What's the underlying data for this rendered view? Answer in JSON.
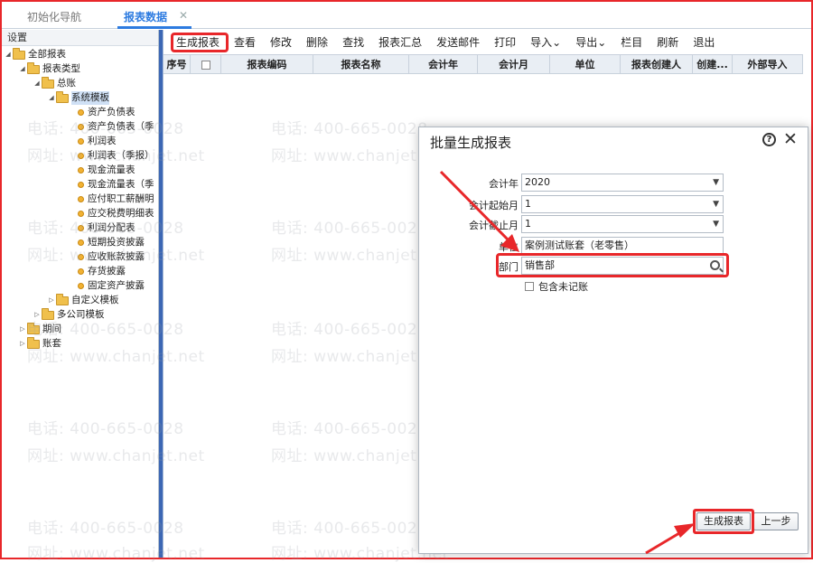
{
  "tabs": [
    {
      "label": "初始化导航"
    },
    {
      "label": "报表数据",
      "close": "✕"
    }
  ],
  "left": {
    "header": "设置",
    "tree": [
      {
        "label": "全部报表",
        "icon": "folder-icon"
      },
      {
        "label": "报表类型",
        "icon": "folder-icon"
      },
      {
        "label": "总账",
        "icon": "folder-icon"
      },
      {
        "label": "系统模板",
        "icon": "folder-icon"
      },
      {
        "label": "资产负债表",
        "icon": "report-icon"
      },
      {
        "label": "资产负债表（季",
        "icon": "report-icon"
      },
      {
        "label": "利润表",
        "icon": "report-icon"
      },
      {
        "label": "利润表（季报）",
        "icon": "report-icon"
      },
      {
        "label": "现金流量表",
        "icon": "report-icon"
      },
      {
        "label": "现金流量表（季",
        "icon": "report-icon"
      },
      {
        "label": "应付职工薪酬明",
        "icon": "report-icon"
      },
      {
        "label": "应交税费明细表",
        "icon": "report-icon"
      },
      {
        "label": "利润分配表",
        "icon": "report-icon"
      },
      {
        "label": "短期投资披露",
        "icon": "report-icon"
      },
      {
        "label": "应收账款披露",
        "icon": "report-icon"
      },
      {
        "label": "存货披露",
        "icon": "report-icon"
      },
      {
        "label": "固定资产披露",
        "icon": "report-icon"
      },
      {
        "label": "自定义模板",
        "icon": "folder-icon"
      },
      {
        "label": "多公司模板",
        "icon": "folder-icon"
      },
      {
        "label": "期间",
        "icon": "folder-icon"
      },
      {
        "label": "账套",
        "icon": "folder-icon"
      }
    ]
  },
  "toolbar": {
    "buttons": [
      "生成报表",
      "查看",
      "修改",
      "删除",
      "查找",
      "报表汇总",
      "发送邮件",
      "打印",
      "导入",
      "导出",
      "栏目",
      "刷新",
      "退出"
    ],
    "dropdown_caret": "⌄"
  },
  "grid": {
    "columns": [
      "序号",
      "",
      "报表编码",
      "报表名称",
      "会计年",
      "会计月",
      "单位",
      "报表创建人",
      "创建...",
      "外部导入"
    ]
  },
  "dialog": {
    "title": "批量生成报表",
    "help": "?",
    "close": "✕",
    "fields": [
      {
        "label": "会计年",
        "value": "2020"
      },
      {
        "label": "会计起始月",
        "value": "1"
      },
      {
        "label": "会计截止月",
        "value": "1"
      },
      {
        "label": "单位",
        "value": "案例测试账套（老零售）"
      },
      {
        "label": "部门",
        "value": "销售部"
      }
    ],
    "include_unposted": "包含未记账",
    "generate": "生成报表",
    "prev": "上一步"
  },
  "watermark": {
    "phone": "电话: 400-665-0028",
    "site": "网址: www.chanjet.net"
  },
  "colors": {
    "accent": "#2d7be0",
    "highlight": "#e8272a",
    "splitter": "#3c67b4"
  }
}
